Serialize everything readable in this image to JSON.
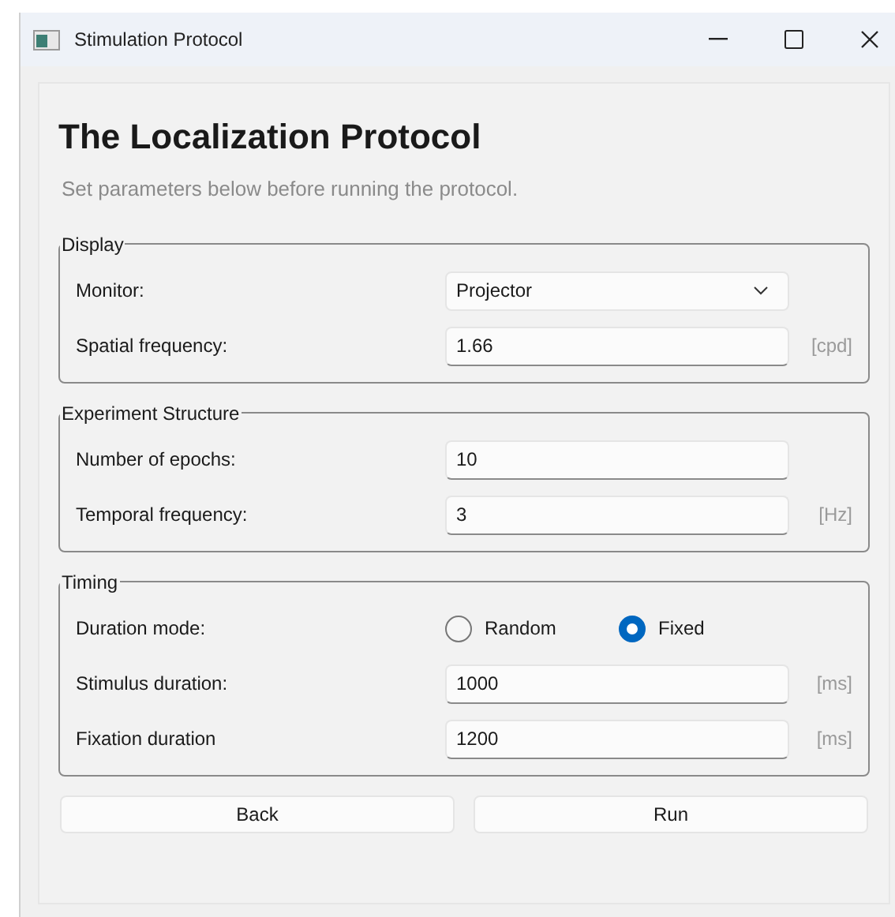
{
  "window": {
    "title": "Stimulation Protocol"
  },
  "heading": "The Localization Protocol",
  "subtitle": "Set parameters below before running the protocol.",
  "groups": [
    {
      "title": "Display",
      "rows": [
        {
          "label": "Monitor:",
          "kind": "select",
          "value": "Projector"
        },
        {
          "label": "Spatial frequency:",
          "kind": "text",
          "value": "1.66",
          "unit": "[cpd]"
        }
      ]
    },
    {
      "title": "Experiment Structure",
      "rows": [
        {
          "label": "Number of epochs:",
          "kind": "text",
          "value": "10"
        },
        {
          "label": "Temporal frequency:",
          "kind": "text",
          "value": "3",
          "unit": "[Hz]"
        }
      ]
    },
    {
      "title": "Timing",
      "rows": [
        {
          "label": "Duration mode:",
          "kind": "radio",
          "options": [
            {
              "label": "Random",
              "selected": false
            },
            {
              "label": "Fixed",
              "selected": true
            }
          ]
        },
        {
          "label": "Stimulus duration:",
          "kind": "text",
          "value": "1000",
          "unit": "[ms]"
        },
        {
          "label": "Fixation duration",
          "kind": "text",
          "value": "1200",
          "unit": "[ms]"
        }
      ]
    }
  ],
  "buttons": [
    "Back",
    "Run"
  ]
}
